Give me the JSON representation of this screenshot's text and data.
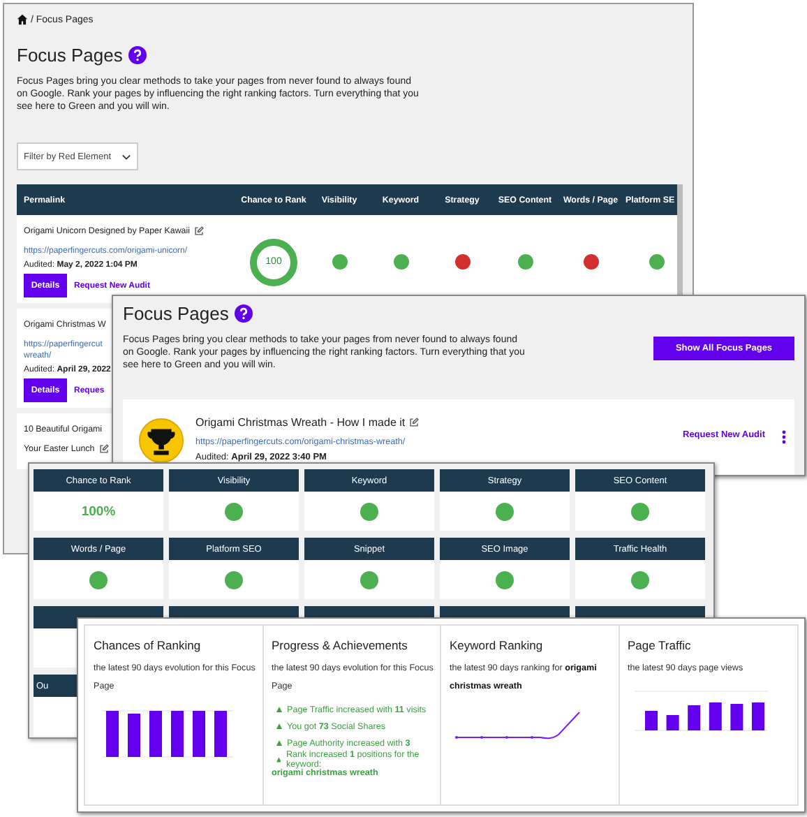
{
  "back_window": {
    "breadcrumb": "/ Focus Pages",
    "title": "Focus Pages",
    "description": "Focus Pages bring you clear methods to take your pages from never found to always found on Google. Rank your pages by influencing the right ranking factors. Turn everything that you see here to Green and you will win.",
    "filter": {
      "value": "Filter by Red Element"
    },
    "table": {
      "columns": [
        "Permalink",
        "Chance to Rank",
        "Visibility",
        "Keyword",
        "Strategy",
        "SEO Content",
        "Words / Page",
        "Platform SE"
      ],
      "rows": [
        {
          "title_lines": [
            "Origami Unicorn Designed by Paper Kawaii"
          ],
          "editable": true,
          "url_lines": [
            "https://paperfingercuts.com/origami-unicorn/"
          ],
          "audited_label": "Audited:",
          "audited": "May 2, 2022 1:04 PM",
          "details": "Details",
          "request": "Request New Audit",
          "chance": "100",
          "signals": [
            {
              "color": "#4caf50"
            },
            {
              "color": "#4caf50"
            },
            {
              "color": "#d32f2f"
            },
            {
              "color": "#4caf50"
            },
            {
              "color": "#d32f2f"
            },
            {
              "color": "#4caf50"
            }
          ]
        },
        {
          "title_lines": [
            "Origami Christmas W"
          ],
          "editable": false,
          "url_lines": [
            "https://paperfingercut",
            "wreath/"
          ],
          "audited_label": "Audited:",
          "audited": "April 29, 2022",
          "details": "Details",
          "request": "Reques"
        },
        {
          "title_lines": [
            "10 Beautiful Origami",
            "Your Easter Lunch"
          ],
          "editable": true
        }
      ]
    }
  },
  "detail_window": {
    "title": "Focus Pages",
    "description": "Focus Pages bring you clear methods to take your pages from never found to always found on Google. Rank your pages by influencing the right ranking factors. Turn everything that you see here to Green and you will win.",
    "show_all_button": "Show All Focus Pages",
    "page": {
      "title": "Origami Christmas Wreath - How I made it",
      "url": "https://paperfingercuts.com/origami-christmas-wreath/",
      "audited_label": "Audited:",
      "audited": "April 29, 2022 3:40 PM",
      "request": "Request New Audit"
    }
  },
  "metrics_window": {
    "cells": [
      {
        "label": "Chance to Rank",
        "kind": "value",
        "value": "100%"
      },
      {
        "label": "Visibility",
        "kind": "dot",
        "color": "#4caf50"
      },
      {
        "label": "Keyword",
        "kind": "dot",
        "color": "#4caf50"
      },
      {
        "label": "Strategy",
        "kind": "dot",
        "color": "#4caf50"
      },
      {
        "label": "SEO Content",
        "kind": "dot",
        "color": "#4caf50"
      },
      {
        "label": "Words / Page",
        "kind": "dot",
        "color": "#4caf50"
      },
      {
        "label": "Platform SEO",
        "kind": "dot",
        "color": "#4caf50"
      },
      {
        "label": "Snippet",
        "kind": "dot",
        "color": "#4caf50"
      },
      {
        "label": "SEO Image",
        "kind": "dot",
        "color": "#4caf50"
      },
      {
        "label": "Traffic Health",
        "kind": "dot",
        "color": "#4caf50"
      },
      {
        "kind": "hidden"
      },
      {
        "kind": "hidden"
      },
      {
        "kind": "hidden"
      },
      {
        "kind": "hidden"
      },
      {
        "kind": "hidden"
      },
      {
        "label": "Ou",
        "kind": "hidden"
      }
    ]
  },
  "charts_window": {
    "panels": [
      {
        "kind": "bars",
        "title": "Chances of Ranking",
        "subtitle": "the latest 90 days evolution for this Focus Page"
      },
      {
        "kind": "list",
        "title": "Progress & Achievements",
        "subtitle": "the latest 90 days evolution for this Focus Page",
        "items": [
          "Page Traffic increased with **11** visits",
          "You got **73** Social Shares",
          "Page Authority increased with **3**",
          "Rank increased **1** positions for the keyword:"
        ],
        "keyword": "origami christmas wreath"
      },
      {
        "kind": "line",
        "title": "Keyword Ranking",
        "subtitle": "the latest 90 days ranking for **origami christmas wreath**"
      },
      {
        "kind": "traffic",
        "title": "Page Traffic",
        "subtitle": "the latest 90 days page views"
      }
    ]
  }
}
